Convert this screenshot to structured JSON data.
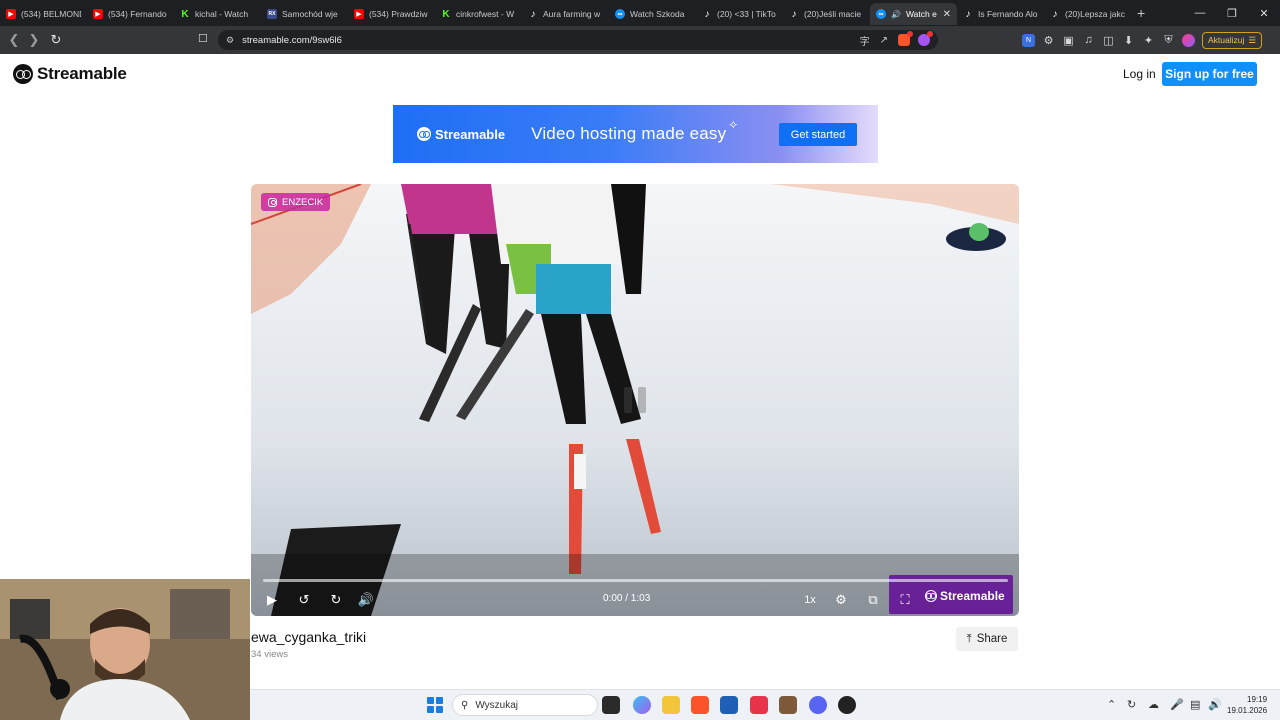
{
  "browser": {
    "tabs": [
      {
        "label": "(534) BELMONDO",
        "favicon": "youtube-icon",
        "active": false
      },
      {
        "label": "(534) Fernando",
        "favicon": "youtube-icon",
        "active": false
      },
      {
        "label": "kichal - Watch",
        "favicon": "kick-icon",
        "active": false
      },
      {
        "label": "Samochód wje",
        "favicon": "car-site-icon",
        "active": false
      },
      {
        "label": "(534) Prawdziw",
        "favicon": "youtube-icon",
        "active": false
      },
      {
        "label": "cinkrofwest - W",
        "favicon": "kick-icon",
        "active": false
      },
      {
        "label": "Aura farming w",
        "favicon": "tiktok-icon",
        "active": false
      },
      {
        "label": "Watch Szkoda",
        "favicon": "streamable-icon",
        "active": false
      },
      {
        "label": "(20) <33 | TikTo",
        "favicon": "tiktok-icon",
        "active": false
      },
      {
        "label": "(20)Jeśli macie",
        "favicon": "tiktok-icon",
        "active": false
      },
      {
        "label": "Watch e",
        "favicon": "streamable-icon",
        "active": true
      },
      {
        "label": "Is Fernando Alo",
        "favicon": "tiktok-icon",
        "active": false
      },
      {
        "label": "(20)Lepsza jakc",
        "favicon": "tiktok-icon",
        "active": false
      }
    ],
    "url": "streamable.com/9sw6l6",
    "update_label": "Aktualizuj"
  },
  "site": {
    "brand": "Streamable",
    "login_label": "Log in",
    "signup_label": "Sign up for free"
  },
  "banner": {
    "brand": "Streamable",
    "tagline": "Video hosting made easy",
    "cta": "Get started"
  },
  "video": {
    "uploader_badge": "ENZECIK",
    "time": "0:00 / 1:03",
    "progress": 0.0,
    "speed": "1x",
    "watermark": "Streamable",
    "title": "ewa_cyganka_triki",
    "views": "34 views",
    "share_label": "Share"
  },
  "taskbar": {
    "search_placeholder": "Wyszukaj",
    "time": "19:19",
    "date": "19.01.2026"
  },
  "colors": {
    "accent": "#0f90fa",
    "tab_bg": "#1e1f22",
    "toolbar_bg": "#35363a"
  }
}
